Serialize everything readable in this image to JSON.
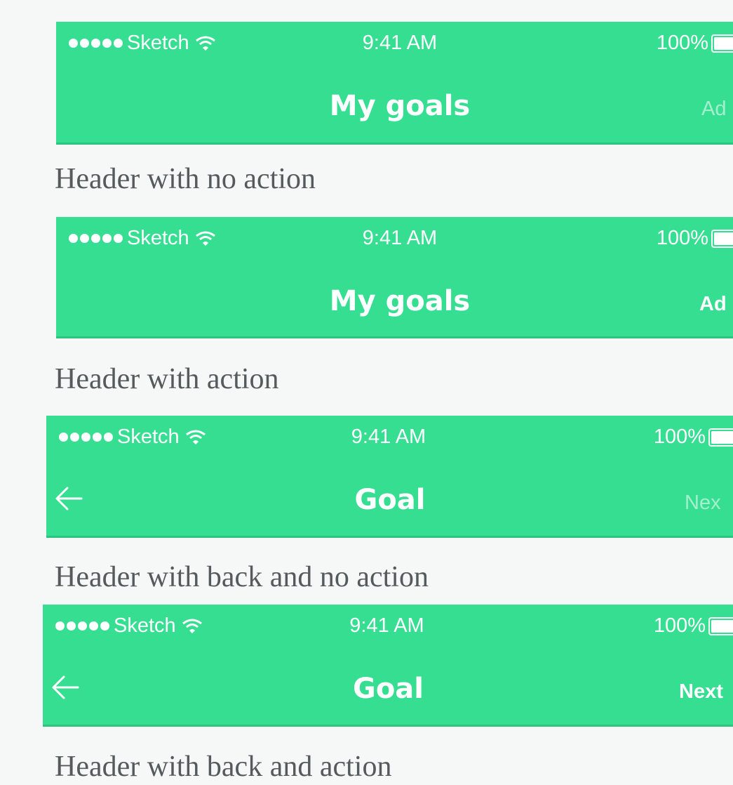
{
  "status_bar": {
    "carrier": "Sketch",
    "time": "9:41 AM",
    "battery": "100%"
  },
  "headers": [
    {
      "title": "My goals",
      "action": "Ad",
      "caption": "Header with no action"
    },
    {
      "title": "My goals",
      "action": "Ad",
      "caption": "Header with action"
    },
    {
      "title": "Goal",
      "action": "Nex",
      "caption": "Header with back and no action"
    },
    {
      "title": "Goal",
      "action": "Next",
      "caption": "Header with back and action"
    }
  ],
  "colors": {
    "header_bg": "#36de92",
    "caption_text": "#555b5d",
    "page_bg": "#f6f7f7"
  },
  "icons": [
    "wifi-icon",
    "battery-icon",
    "back-arrow-icon"
  ]
}
